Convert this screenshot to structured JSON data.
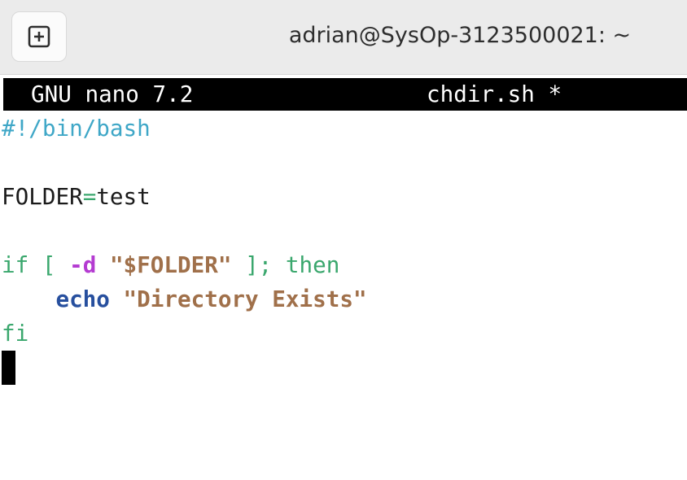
{
  "window": {
    "title": "adrian@SysOp-3123500021: ~",
    "new_tab_icon": "plus-square-icon"
  },
  "nano": {
    "version": "GNU nano 7.2",
    "filename": "chdir.sh *"
  },
  "code": {
    "line1": {
      "shebang": "#!/bin/bash"
    },
    "line3": {
      "var": "FOLDER",
      "eq": "=",
      "value": "test"
    },
    "line5": {
      "kw_if": "if",
      "open_bracket": " [ ",
      "opt": "-d",
      "sp": " ",
      "str": "\"$FOLDER\"",
      "close": " ]; ",
      "kw_then": "then"
    },
    "line6": {
      "indent": "    ",
      "cmd": "echo",
      "sp": " ",
      "str": "\"Directory Exists\""
    },
    "line7": {
      "kw_fi": "fi"
    }
  },
  "colors": {
    "shebang": "#3fa7c7",
    "keyword": "#3aa76d",
    "option": "#b43bd1",
    "string": "#a0704a",
    "builtin": "#274f9e"
  }
}
